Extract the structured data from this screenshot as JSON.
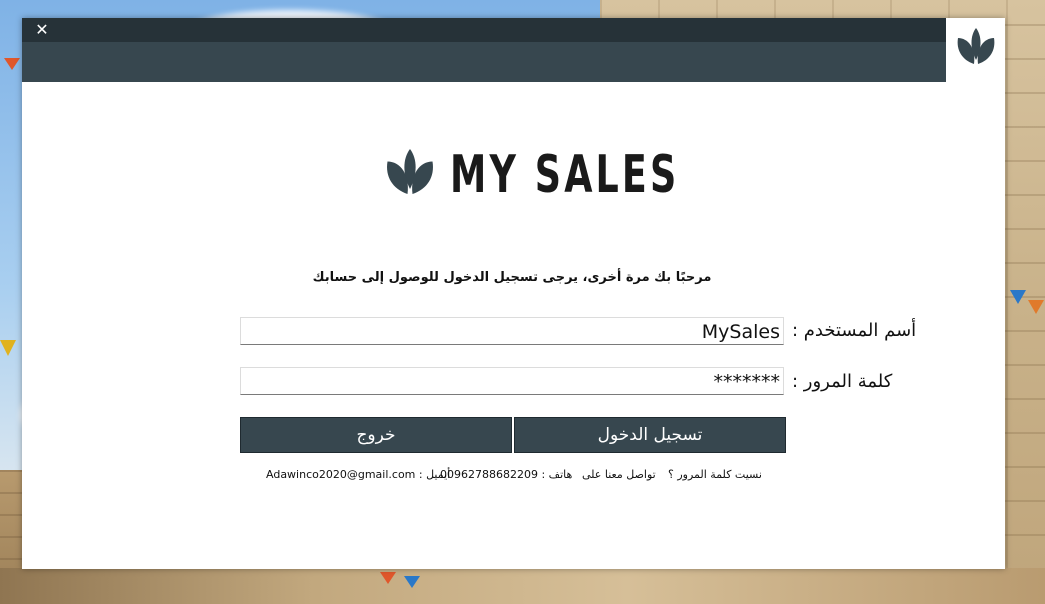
{
  "window": {
    "close_glyph": "✕"
  },
  "brand": {
    "name": "MY SALES"
  },
  "welcome": "مرحبًا بك مرة أخرى، يرجى تسجيل الدخول للوصول إلى حسابك",
  "form": {
    "username_label": "أسم المستخدم :",
    "username_value": "MySales",
    "password_label": "كلمة المرور :",
    "password_value": "*******"
  },
  "buttons": {
    "exit": "خروج",
    "login": "تسجيل الدخول"
  },
  "footer": {
    "forgot": "نسيت كلمة المرور ؟",
    "contact": "تواصل معنا على",
    "phone": "هاتف : 00962788682209",
    "email": "أيميل : Adawinco2020@gmail.com"
  },
  "colors": {
    "titlebar": "#37474f",
    "titlebar_top": "#263238",
    "button": "#37474f"
  }
}
